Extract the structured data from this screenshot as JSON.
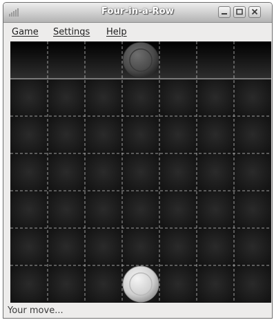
{
  "window": {
    "title": "Four-in-a-Row"
  },
  "menu": {
    "items": [
      {
        "label": "Game"
      },
      {
        "label": "Settings"
      },
      {
        "label": "Help"
      }
    ]
  },
  "board": {
    "columns": 7,
    "rows": 7,
    "pieces": [
      {
        "row": 0,
        "col": 3,
        "color": "dark"
      },
      {
        "row": 6,
        "col": 3,
        "color": "light"
      }
    ],
    "colors": {
      "background": "#1b1b1b",
      "grid_line": "#cfcfcf",
      "dark_piece": "#555555",
      "light_piece": "#d8d8d8"
    }
  },
  "status": {
    "text": "Your move..."
  }
}
